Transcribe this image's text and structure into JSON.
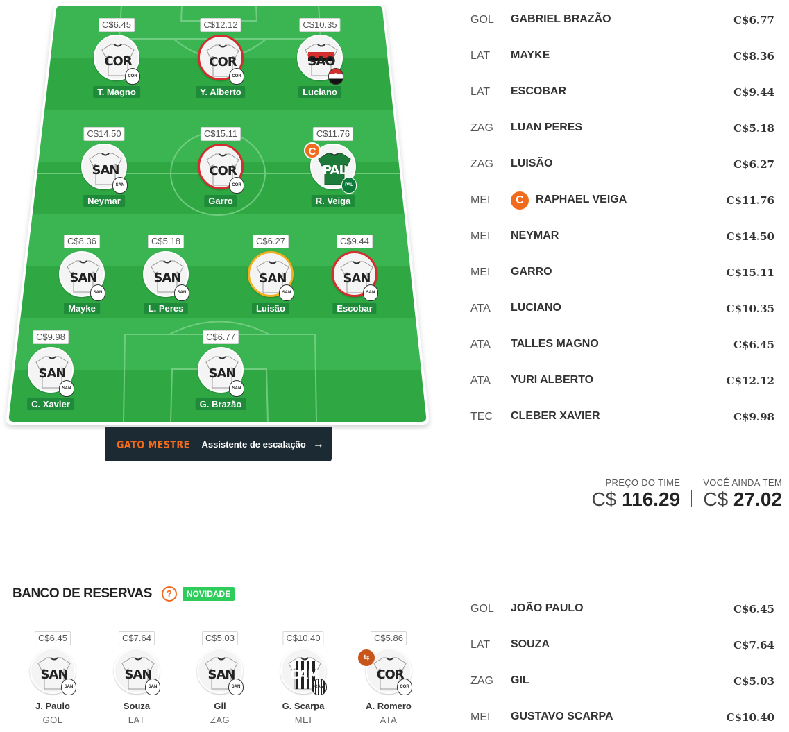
{
  "field": {
    "players": [
      {
        "id": "t-magno",
        "name": "T. Magno",
        "price": "C$6.45",
        "club": "COR",
        "badge": "COR",
        "style": "white",
        "ring": "none"
      },
      {
        "id": "y-alberto",
        "name": "Y. Alberto",
        "price": "C$12.12",
        "club": "COR",
        "badge": "COR",
        "style": "white",
        "ring": "red"
      },
      {
        "id": "luciano",
        "name": "Luciano",
        "price": "C$10.35",
        "club": "SAO",
        "badge": "SÃO",
        "style": "sao",
        "ring": "none"
      },
      {
        "id": "neymar",
        "name": "Neymar",
        "price": "C$14.50",
        "club": "SAN",
        "badge": "SAN",
        "style": "white",
        "ring": "none"
      },
      {
        "id": "garro",
        "name": "Garro",
        "price": "C$15.11",
        "club": "COR",
        "badge": "COR",
        "style": "white",
        "ring": "red"
      },
      {
        "id": "r-veiga",
        "name": "R. Veiga",
        "price": "C$11.76",
        "club": "PAL",
        "badge": "PAL",
        "style": "pal",
        "ring": "none",
        "captain": "C"
      },
      {
        "id": "mayke",
        "name": "Mayke",
        "price": "C$8.36",
        "club": "SAN",
        "badge": "SAN",
        "style": "white",
        "ring": "none"
      },
      {
        "id": "l-peres",
        "name": "L. Peres",
        "price": "C$5.18",
        "club": "SAN",
        "badge": "SAN",
        "style": "white",
        "ring": "none"
      },
      {
        "id": "luisao",
        "name": "Luisão",
        "price": "C$6.27",
        "club": "SAN",
        "badge": "SAN",
        "style": "white",
        "ring": "yellow"
      },
      {
        "id": "escobar",
        "name": "Escobar",
        "price": "C$9.44",
        "club": "SAN",
        "badge": "SAN",
        "style": "white",
        "ring": "red"
      },
      {
        "id": "c-xavier",
        "name": "C. Xavier",
        "price": "C$9.98",
        "club": "SAN",
        "badge": "SAN",
        "style": "white",
        "ring": "none"
      },
      {
        "id": "g-brazao",
        "name": "G. Brazão",
        "price": "C$6.77",
        "club": "SAN",
        "badge": "SAN",
        "style": "white",
        "ring": "none"
      }
    ]
  },
  "assistant": {
    "brand": "GATO MESTRE",
    "label": "Assistente de escalação",
    "arrow": "→"
  },
  "lineup": [
    {
      "pos": "GOL",
      "name": "GABRIEL BRAZÃO",
      "price": "C$6.77"
    },
    {
      "pos": "LAT",
      "name": "MAYKE",
      "price": "C$8.36"
    },
    {
      "pos": "LAT",
      "name": "ESCOBAR",
      "price": "C$9.44"
    },
    {
      "pos": "ZAG",
      "name": "LUAN PERES",
      "price": "C$5.18"
    },
    {
      "pos": "ZAG",
      "name": "LUISÃO",
      "price": "C$6.27"
    },
    {
      "pos": "MEI",
      "name": "RAPHAEL VEIGA",
      "price": "C$11.76",
      "captain": "C"
    },
    {
      "pos": "MEI",
      "name": "NEYMAR",
      "price": "C$14.50"
    },
    {
      "pos": "MEI",
      "name": "GARRO",
      "price": "C$15.11"
    },
    {
      "pos": "ATA",
      "name": "LUCIANO",
      "price": "C$10.35"
    },
    {
      "pos": "ATA",
      "name": "TALLES MAGNO",
      "price": "C$6.45"
    },
    {
      "pos": "ATA",
      "name": "YURI ALBERTO",
      "price": "C$12.12"
    },
    {
      "pos": "TEC",
      "name": "CLEBER XAVIER",
      "price": "C$9.98"
    }
  ],
  "totals": {
    "team_price_label": "PREÇO DO TIME",
    "team_price_currency": "C$",
    "team_price_value": "116.29",
    "remaining_label": "VOCÊ AINDA TEM",
    "remaining_currency": "C$",
    "remaining_value": "27.02"
  },
  "bench": {
    "title": "BANCO DE RESERVAS",
    "help": "?",
    "badge": "NOVIDADE",
    "players": [
      {
        "name": "J. Paulo",
        "pos": "GOL",
        "price": "C$6.45",
        "club": "SAN",
        "badge": "SAN",
        "style": "white"
      },
      {
        "name": "Souza",
        "pos": "LAT",
        "price": "C$7.64",
        "club": "SAN",
        "badge": "SAN",
        "style": "white"
      },
      {
        "name": "Gil",
        "pos": "ZAG",
        "price": "C$5.03",
        "club": "SAN",
        "badge": "SAN",
        "style": "white"
      },
      {
        "name": "G. Scarpa",
        "pos": "MEI",
        "price": "C$10.40",
        "club": "CAM",
        "badge": "CAM",
        "style": "cam"
      },
      {
        "name": "A. Romero",
        "pos": "ATA",
        "price": "C$5.86",
        "club": "COR",
        "badge": "COR",
        "style": "white",
        "swap": "⇆"
      }
    ],
    "list": [
      {
        "pos": "GOL",
        "name": "JOÃO PAULO",
        "price": "C$6.45"
      },
      {
        "pos": "LAT",
        "name": "SOUZA",
        "price": "C$7.64"
      },
      {
        "pos": "ZAG",
        "name": "GIL",
        "price": "C$5.03"
      },
      {
        "pos": "MEI",
        "name": "GUSTAVO SCARPA",
        "price": "C$10.40"
      }
    ]
  },
  "colors": {
    "pitch_dark": "#2fa844",
    "pitch_light": "#3bb552",
    "accent": "#f26a1b",
    "name_tag": "#1f8a3a",
    "badge_green": "#2ecc5a"
  }
}
